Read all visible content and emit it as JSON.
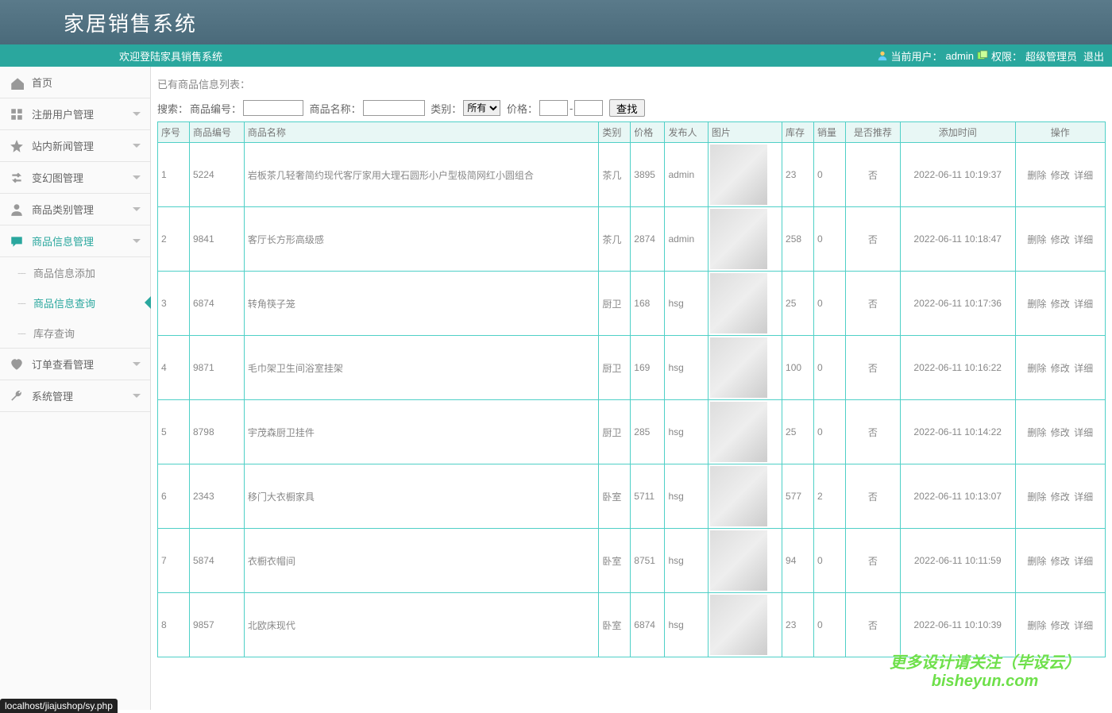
{
  "header": {
    "title": "家居销售系统",
    "welcome": "欢迎登陆家具销售系统",
    "current_user_label": "当前用户：",
    "current_user": "admin",
    "perm_label": "权限：",
    "perm_value": "超级管理员",
    "logout": "退出"
  },
  "sidebar": {
    "items": [
      {
        "label": "首页",
        "icon": "home"
      },
      {
        "label": "注册用户管理",
        "icon": "grid",
        "caret": true
      },
      {
        "label": "站内新闻管理",
        "icon": "star",
        "caret": true
      },
      {
        "label": "变幻图管理",
        "icon": "swap",
        "caret": true
      },
      {
        "label": "商品类别管理",
        "icon": "user",
        "caret": true
      },
      {
        "label": "商品信息管理",
        "icon": "chat",
        "caret": true,
        "active": true
      },
      {
        "label": "订单查看管理",
        "icon": "heart",
        "caret": true
      },
      {
        "label": "系统管理",
        "icon": "wrench",
        "caret": true
      }
    ],
    "sub": [
      {
        "label": "商品信息添加"
      },
      {
        "label": "商品信息查询",
        "active": true
      },
      {
        "label": "库存查询"
      }
    ]
  },
  "main": {
    "list_label": "已有商品信息列表：",
    "search": {
      "label": "搜索：",
      "code_label": "商品编号：",
      "name_label": "商品名称：",
      "cat_label": "类别：",
      "cat_option": "所有",
      "price_label": "价格：",
      "price_dash": "-",
      "btn": "查找"
    },
    "columns": [
      "序号",
      "商品编号",
      "商品名称",
      "类别",
      "价格",
      "发布人",
      "图片",
      "库存",
      "销量",
      "是否推荐",
      "添加时间",
      "操作"
    ],
    "actions": {
      "del": "删除",
      "edit": "修改",
      "detail": "详细"
    },
    "rows": [
      {
        "idx": "1",
        "code": "5224",
        "name": "岩板茶几轻奢简约现代客厅家用大理石圆形小户型极简网红小圆组合",
        "cat": "茶几",
        "price": "3895",
        "pub": "admin",
        "stock": "23",
        "sales": "0",
        "rec": "否",
        "time": "2022-06-11 10:19:37"
      },
      {
        "idx": "2",
        "code": "9841",
        "name": "客厅长方形高级感",
        "cat": "茶几",
        "price": "2874",
        "pub": "admin",
        "stock": "258",
        "sales": "0",
        "rec": "否",
        "time": "2022-06-11 10:18:47"
      },
      {
        "idx": "3",
        "code": "6874",
        "name": "转角筷子笼",
        "cat": "厨卫",
        "price": "168",
        "pub": "hsg",
        "stock": "25",
        "sales": "0",
        "rec": "否",
        "time": "2022-06-11 10:17:36"
      },
      {
        "idx": "4",
        "code": "9871",
        "name": "毛巾架卫生间浴室挂架",
        "cat": "厨卫",
        "price": "169",
        "pub": "hsg",
        "stock": "100",
        "sales": "0",
        "rec": "否",
        "time": "2022-06-11 10:16:22"
      },
      {
        "idx": "5",
        "code": "8798",
        "name": "宇茂森厨卫挂件",
        "cat": "厨卫",
        "price": "285",
        "pub": "hsg",
        "stock": "25",
        "sales": "0",
        "rec": "否",
        "time": "2022-06-11 10:14:22"
      },
      {
        "idx": "6",
        "code": "2343",
        "name": "移门大衣橱家具",
        "cat": "卧室",
        "price": "5711",
        "pub": "hsg",
        "stock": "577",
        "sales": "2",
        "rec": "否",
        "time": "2022-06-11 10:13:07"
      },
      {
        "idx": "7",
        "code": "5874",
        "name": "衣橱衣帽间",
        "cat": "卧室",
        "price": "8751",
        "pub": "hsg",
        "stock": "94",
        "sales": "0",
        "rec": "否",
        "time": "2022-06-11 10:11:59"
      },
      {
        "idx": "8",
        "code": "9857",
        "name": "北欧床现代",
        "cat": "卧室",
        "price": "6874",
        "pub": "hsg",
        "stock": "23",
        "sales": "0",
        "rec": "否",
        "time": "2022-06-11 10:10:39"
      }
    ]
  },
  "status": "localhost/jiajushop/sy.php",
  "watermark": {
    "line1": "更多设计请关注（毕设云）",
    "line2": "bisheyun.com"
  }
}
